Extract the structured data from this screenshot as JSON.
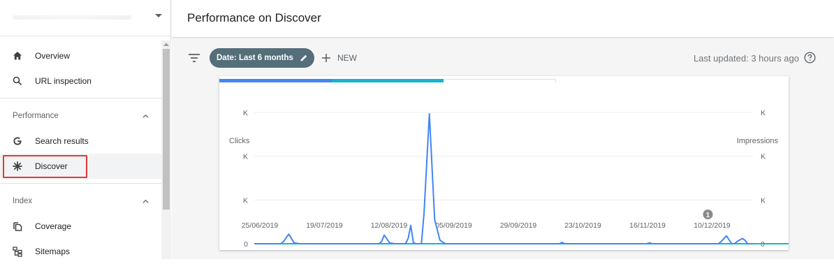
{
  "sidebar": {
    "nav": [
      {
        "label": "Overview",
        "icon": "home-icon"
      },
      {
        "label": "URL inspection",
        "icon": "search-icon"
      }
    ],
    "sections": [
      {
        "label": "Performance",
        "items": [
          {
            "label": "Search results",
            "icon": "google-g-icon"
          },
          {
            "label": "Discover",
            "icon": "asterisk-icon",
            "active": true
          }
        ]
      },
      {
        "label": "Index",
        "items": [
          {
            "label": "Coverage",
            "icon": "copy-icon"
          },
          {
            "label": "Sitemaps",
            "icon": "sitemap-icon"
          }
        ]
      }
    ]
  },
  "header": {
    "title": "Performance on Discover"
  },
  "toolbar": {
    "date_chip": "Date: Last 6 months",
    "new_label": "NEW",
    "last_updated": "Last updated: 3 hours ago"
  },
  "colors": {
    "clicks": "#4285f4",
    "impressions": "#12b5cb",
    "chip": "#546e7a",
    "highlight": "#e53935"
  },
  "chart_data": {
    "type": "line",
    "left_axis_label": "Clicks",
    "right_axis_label": "Impressions",
    "left_ticks": [
      "K",
      "K",
      "K",
      "0"
    ],
    "right_ticks": [
      "K",
      "K",
      "K",
      "0"
    ],
    "x_tick_labels": [
      "25/06/2019",
      "19/07/2019",
      "12/08/2019",
      "05/09/2019",
      "29/09/2019",
      "23/10/2019",
      "16/11/2019",
      "10/12/2019"
    ],
    "x_range": [
      0,
      188
    ],
    "y_range": [
      0,
      3
    ],
    "annotation": {
      "label": "1",
      "day": 171
    },
    "series": [
      {
        "name": "Clicks",
        "points": [
          [
            0,
            0
          ],
          [
            10,
            0
          ],
          [
            11,
            0.05
          ],
          [
            13,
            0.22
          ],
          [
            15,
            0.02
          ],
          [
            17,
            0
          ],
          [
            47,
            0
          ],
          [
            48,
            0.05
          ],
          [
            49,
            0.2
          ],
          [
            51,
            0.02
          ],
          [
            53,
            0
          ],
          [
            57,
            0
          ],
          [
            58,
            0.12
          ],
          [
            59,
            0.42
          ],
          [
            60,
            0.02
          ],
          [
            61,
            0
          ],
          [
            63,
            0
          ],
          [
            64,
            0.7
          ],
          [
            66,
            2.97
          ],
          [
            68,
            0.55
          ],
          [
            70,
            0.08
          ],
          [
            72,
            0
          ],
          [
            115,
            0
          ],
          [
            116,
            0.03
          ],
          [
            117,
            0
          ],
          [
            148,
            0
          ],
          [
            149,
            0.02
          ],
          [
            150,
            0
          ],
          [
            175,
            0
          ],
          [
            176,
            0.05
          ],
          [
            178,
            0.18
          ],
          [
            180,
            0
          ],
          [
            181,
            0
          ],
          [
            182,
            0.05
          ],
          [
            184,
            0.12
          ],
          [
            185,
            0.08
          ],
          [
            186,
            0
          ],
          [
            188,
            0
          ]
        ]
      },
      {
        "name": "Impressions",
        "points": [
          [
            0,
            0
          ],
          [
            210,
            0
          ]
        ]
      }
    ]
  }
}
